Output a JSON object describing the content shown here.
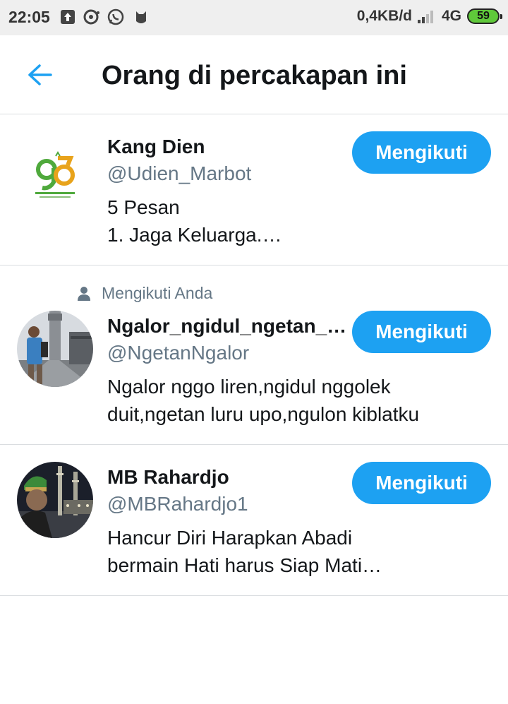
{
  "status_bar": {
    "time": "22:05",
    "data_rate": "0,4KB/d",
    "network": "4G",
    "battery": "59"
  },
  "header": {
    "title": "Orang di percakapan ini"
  },
  "people": [
    {
      "name": "Kang Dien",
      "handle": "@Udien_Marbot",
      "bio_line1": "5 Pesan",
      "bio_line2": "1. Jaga Keluarga.…",
      "follow_label": "Mengikuti",
      "follows_you": ""
    },
    {
      "name": "Ngalor_ngidul_ngetan_n…",
      "handle": "@NgetanNgalor",
      "bio_line1": "Ngalor nggo liren,ngidul nggolek",
      "bio_line2": "duit,ngetan luru upo,ngulon kiblatku",
      "follow_label": "Mengikuti",
      "follows_you": "Mengikuti Anda"
    },
    {
      "name": "MB Rahardjo",
      "handle": "@MBRahardjo1",
      "bio_line1": "Hancur Diri Harapkan Abadi",
      "bio_line2": "bermain Hati harus Siap Mati…",
      "follow_label": "Mengikuti",
      "follows_you": ""
    }
  ],
  "colors": {
    "accent": "#1da1f2",
    "secondary_text": "#657786",
    "divider": "#dadde0"
  }
}
